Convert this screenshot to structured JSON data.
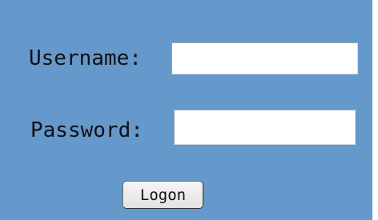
{
  "login_form": {
    "username_label": "Username:",
    "username_value": "",
    "password_label": "Password:",
    "password_value": "",
    "logon_label": "Logon"
  },
  "colors": {
    "panel_background": "#6598cb",
    "input_background": "#ffffff",
    "button_background": "#ececec"
  }
}
